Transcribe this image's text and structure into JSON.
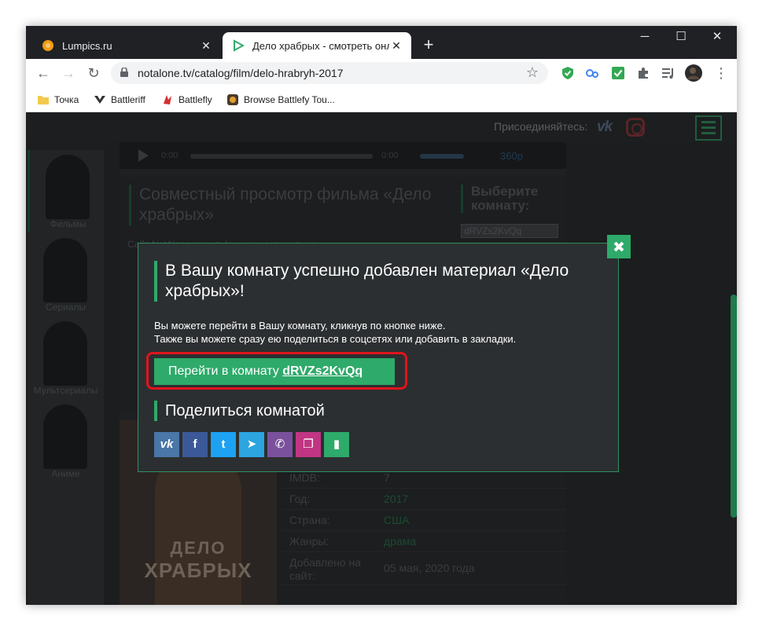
{
  "browser": {
    "tabs": [
      {
        "title": "Lumpics.ru",
        "close": "✕"
      },
      {
        "title": "Дело храбрых - смотреть онла",
        "close": "✕"
      }
    ],
    "new_tab": "+",
    "window_controls": {
      "minimize": "─",
      "maximize": "☐",
      "close": "✕"
    },
    "nav": {
      "back": "←",
      "forward": "→",
      "reload": "↻"
    },
    "url": "notalone.tv/catalog/film/delo-hrabryh-2017",
    "star": "☆",
    "menu": "⋮",
    "bookmarks": [
      "Точка",
      "Battleriff",
      "Battlefly",
      "Browse Battlefy Tou..."
    ]
  },
  "site": {
    "join_label": "Присоединяйтесь:",
    "vk": "vk",
    "categories": [
      "Фильмы",
      "Сериалы",
      "Мультсериалы",
      "Аниме"
    ],
    "player": {
      "time_start": "0:00",
      "time_end": "0:00",
      "quality": "360p"
    },
    "joint": {
      "title": "Совместный просмотр фильма «Дело храбрых»",
      "pick_room": "Выберите комнату:",
      "room": "dRVZs2KvQq",
      "text": "Сайт NotAlone имеет функцию совместного"
    },
    "poster": {
      "line1": "ДЕЛО",
      "line2": "ХРАБРЫХ"
    },
    "info": [
      {
        "key": "IMDB:",
        "value": "7"
      },
      {
        "key": "Год:",
        "value": "2017"
      },
      {
        "key": "Страна:",
        "value": "США"
      },
      {
        "key": "Жанры:",
        "value": "драма"
      },
      {
        "key": "Добавлено на сайт:",
        "value": "05 мая, 2020 года"
      }
    ]
  },
  "modal": {
    "title": "В Вашу комнату успешно добавлен материал «Дело храбрых»!",
    "text_line1": "Вы можете перейти в Вашу комнату, кликнув по кнопке ниже.",
    "text_line2": "Также вы можете сразу ею поделиться в соцсетях или добавить в закладки.",
    "go_label": "Перейти в комнату ",
    "room_code": "dRVZs2KvQq",
    "share_title": "Поделиться комнатой",
    "share": [
      {
        "name": "vk",
        "glyph": "vk",
        "color": "#4a76a8"
      },
      {
        "name": "facebook",
        "glyph": "f",
        "color": "#3b5998"
      },
      {
        "name": "twitter",
        "glyph": "t",
        "color": "#1da1f2"
      },
      {
        "name": "telegram",
        "glyph": "➤",
        "color": "#2ca5e0"
      },
      {
        "name": "viber",
        "glyph": "✆",
        "color": "#7b519d"
      },
      {
        "name": "copy",
        "glyph": "❐",
        "color": "#c13584"
      },
      {
        "name": "bookmark",
        "glyph": "▮",
        "color": "#2eaa6a"
      }
    ]
  },
  "colors": {
    "accent": "#2eaa6a",
    "highlight": "#e0141c"
  }
}
